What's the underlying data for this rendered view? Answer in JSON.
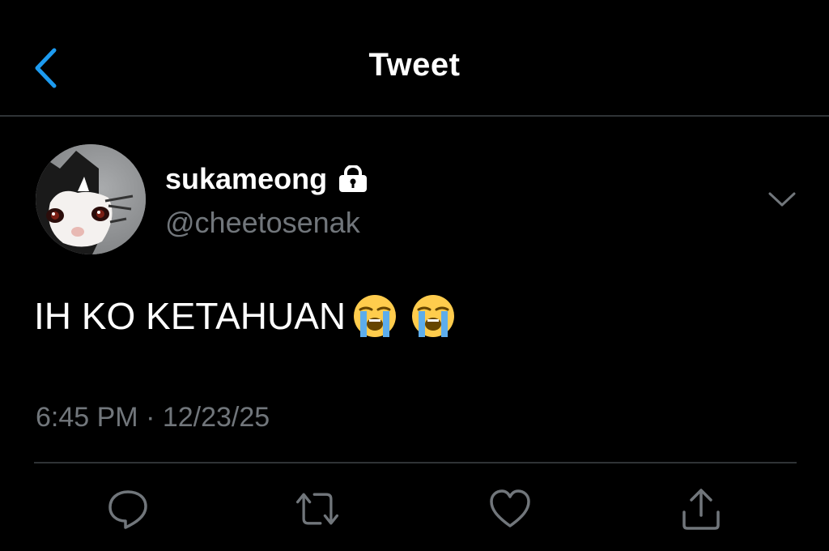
{
  "header": {
    "title": "Tweet",
    "back_icon": "chevron-left-icon"
  },
  "colors": {
    "background": "#000000",
    "accent": "#1d9bf0",
    "secondary_text": "#71767b",
    "divider": "#2f3336"
  },
  "tweet": {
    "author": {
      "display_name": "sukameong",
      "handle": "@cheetosenak",
      "protected_icon": "lock-icon",
      "avatar_icon": "cat-avatar"
    },
    "text": "IH KO KETAHUAN",
    "emojis": [
      "😭",
      "😭"
    ],
    "emoji_icon": "loudly-crying-face-icon",
    "meta": "6:45 PM · 12/23/25",
    "more_icon": "chevron-down-icon"
  },
  "actions": [
    {
      "name": "reply",
      "icon": "reply-icon"
    },
    {
      "name": "retweet",
      "icon": "retweet-icon"
    },
    {
      "name": "like",
      "icon": "heart-icon"
    },
    {
      "name": "share",
      "icon": "share-icon"
    }
  ]
}
